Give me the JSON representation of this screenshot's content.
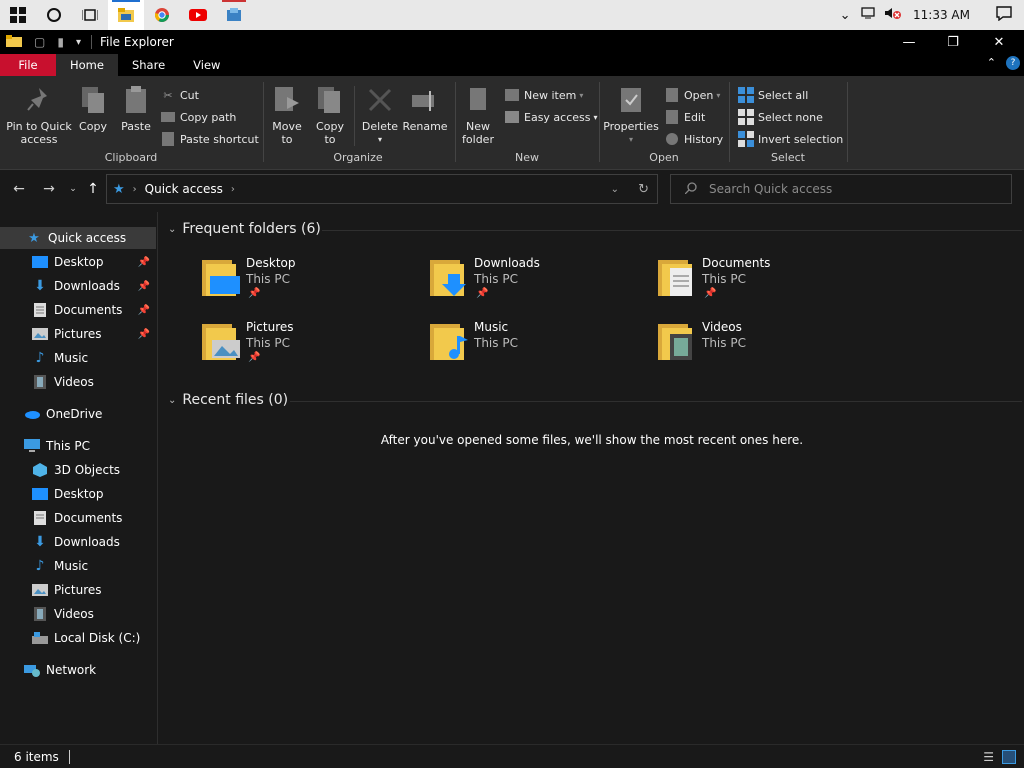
{
  "taskbar": {
    "clock": "11:33 AM"
  },
  "window": {
    "title": "File Explorer"
  },
  "tabs": {
    "file": "File",
    "home": "Home",
    "share": "Share",
    "view": "View"
  },
  "ribbon": {
    "clipboard": {
      "label": "Clipboard",
      "pin": "Pin to Quick access",
      "copy": "Copy",
      "paste": "Paste",
      "cut": "Cut",
      "copy_path": "Copy path",
      "paste_shortcut": "Paste shortcut"
    },
    "organize": {
      "label": "Organize",
      "move_to": "Move to",
      "copy_to": "Copy to",
      "delete": "Delete",
      "rename": "Rename"
    },
    "new": {
      "label": "New",
      "new_folder": "New folder",
      "new_item": "New item",
      "easy_access": "Easy access"
    },
    "open": {
      "label": "Open",
      "properties": "Properties",
      "open": "Open",
      "edit": "Edit",
      "history": "History"
    },
    "select": {
      "label": "Select",
      "select_all": "Select all",
      "select_none": "Select none",
      "invert": "Invert selection"
    }
  },
  "address": {
    "path": "Quick access",
    "search_placeholder": "Search Quick access"
  },
  "nav": {
    "quick_access": "Quick access",
    "qa_items": [
      "Desktop",
      "Downloads",
      "Documents",
      "Pictures",
      "Music",
      "Videos"
    ],
    "onedrive": "OneDrive",
    "this_pc": "This PC",
    "pc_items": [
      "3D Objects",
      "Desktop",
      "Documents",
      "Downloads",
      "Music",
      "Pictures",
      "Videos",
      "Local Disk (C:)"
    ],
    "network": "Network"
  },
  "content": {
    "frequent_header": "Frequent folders (6)",
    "recent_header": "Recent files (0)",
    "recent_empty": "After you've opened some files, we'll show the most recent ones here.",
    "folders": [
      {
        "name": "Desktop",
        "location": "This PC",
        "pinned": true
      },
      {
        "name": "Downloads",
        "location": "This PC",
        "pinned": true
      },
      {
        "name": "Documents",
        "location": "This PC",
        "pinned": true
      },
      {
        "name": "Pictures",
        "location": "This PC",
        "pinned": true
      },
      {
        "name": "Music",
        "location": "This PC",
        "pinned": false
      },
      {
        "name": "Videos",
        "location": "This PC",
        "pinned": false
      }
    ]
  },
  "status": {
    "items": "6 items"
  },
  "colors": {
    "file_tab": "#c8102e",
    "folder_yellow": "#e9c46a",
    "accent_blue": "#1e90ff"
  }
}
